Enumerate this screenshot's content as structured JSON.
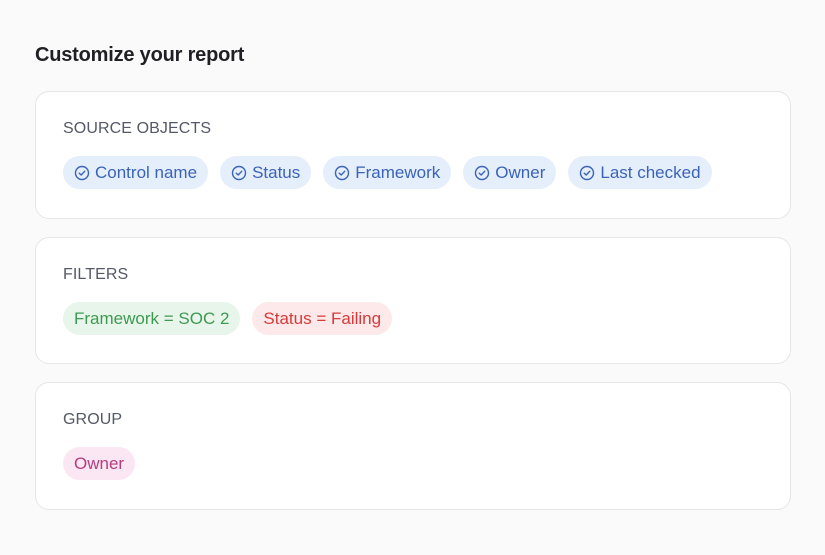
{
  "page": {
    "title": "Customize your report"
  },
  "source_objects": {
    "label": "SOURCE OBJECTS",
    "icon": "check-circle-icon",
    "items": [
      {
        "label": "Control name"
      },
      {
        "label": "Status"
      },
      {
        "label": "Framework"
      },
      {
        "label": "Owner"
      },
      {
        "label": "Last checked"
      }
    ]
  },
  "filters": {
    "label": "FILTERS",
    "items": [
      {
        "label": "Framework = SOC 2",
        "color": "#3e9a52"
      },
      {
        "label": "Status = Failing",
        "color": "#d63a3a"
      }
    ]
  },
  "group": {
    "label": "GROUP",
    "items": [
      {
        "label": "Owner",
        "color": "#b43d7e"
      }
    ]
  },
  "colors": {
    "source_chip_bg": "#e5eefb",
    "source_chip_text": "#3b63b8"
  }
}
